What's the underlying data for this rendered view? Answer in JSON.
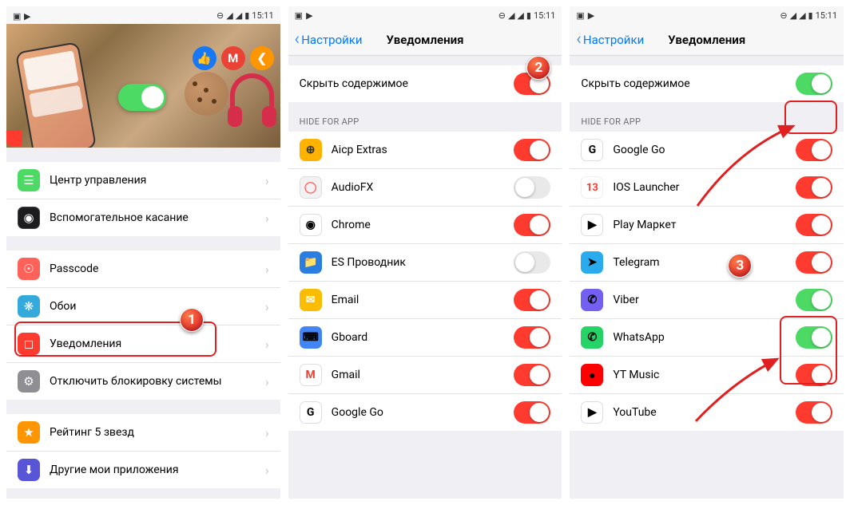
{
  "status": {
    "time": "15:11"
  },
  "phone1": {
    "rows_a": [
      {
        "icon_class": "ic-control",
        "glyph": "☰",
        "label": "Центр управления"
      },
      {
        "icon_class": "ic-assist",
        "glyph": "◉",
        "label": "Вспомогательное касание"
      }
    ],
    "rows_b": [
      {
        "icon_class": "ic-pass",
        "glyph": "☉",
        "label": "Passcode"
      },
      {
        "icon_class": "ic-wall",
        "glyph": "❋",
        "label": "Обои"
      },
      {
        "icon_class": "ic-notif",
        "glyph": "◻",
        "label": "Уведомления"
      },
      {
        "icon_class": "ic-lock",
        "glyph": "⚙",
        "label": "Отключить блокировку системы"
      }
    ],
    "rows_c": [
      {
        "icon_class": "ic-star",
        "glyph": "★",
        "label": "Рейтинг 5 звезд"
      },
      {
        "icon_class": "ic-apps",
        "glyph": "⬇",
        "label": "Другие мои приложения"
      }
    ]
  },
  "phone2": {
    "back": "Настройки",
    "title": "Уведомления",
    "hide_label": "Скрыть содержимое",
    "hide_state": "off",
    "section": "HIDE FOR APP",
    "apps": [
      {
        "ic": "ic-aicp",
        "glyph": "⊕",
        "name": "Aicp Extras",
        "state": "off"
      },
      {
        "ic": "ic-audiofx",
        "glyph": "◯",
        "name": "AudioFX",
        "state": "neutral-off"
      },
      {
        "ic": "ic-chrome",
        "glyph": "◉",
        "name": "Chrome",
        "state": "off"
      },
      {
        "ic": "ic-es",
        "glyph": "📁",
        "name": "ES Проводник",
        "state": "neutral-off"
      },
      {
        "ic": "ic-email",
        "glyph": "✉",
        "name": "Email",
        "state": "off"
      },
      {
        "ic": "ic-gboard",
        "glyph": "⌨",
        "name": "Gboard",
        "state": "off"
      },
      {
        "ic": "ic-gmail",
        "glyph": "M",
        "name": "Gmail",
        "state": "off"
      },
      {
        "ic": "ic-ggo",
        "glyph": "G",
        "name": "Google Go",
        "state": "off"
      }
    ]
  },
  "phone3": {
    "back": "Настройки",
    "title": "Уведомления",
    "hide_label": "Скрыть содержимое",
    "hide_state": "on",
    "section": "HIDE FOR APP",
    "apps": [
      {
        "ic": "ic-ggo",
        "glyph": "G",
        "name": "Google Go",
        "state": "off"
      },
      {
        "ic": "ic-ios",
        "glyph": "13",
        "name": "IOS Launcher",
        "state": "off"
      },
      {
        "ic": "ic-play",
        "glyph": "▶",
        "name": "Play Маркет",
        "state": "off"
      },
      {
        "ic": "ic-tg",
        "glyph": "➤",
        "name": "Telegram",
        "state": "off"
      },
      {
        "ic": "ic-viber",
        "glyph": "✆",
        "name": "Viber",
        "state": "on"
      },
      {
        "ic": "ic-wa",
        "glyph": "✆",
        "name": "WhatsApp",
        "state": "on"
      },
      {
        "ic": "ic-ytm",
        "glyph": "●",
        "name": "YT Music",
        "state": "off"
      },
      {
        "ic": "ic-yt",
        "glyph": "▶",
        "name": "YouTube",
        "state": "off"
      }
    ]
  },
  "markers": {
    "m1": "1",
    "m2": "2",
    "m3": "3"
  }
}
